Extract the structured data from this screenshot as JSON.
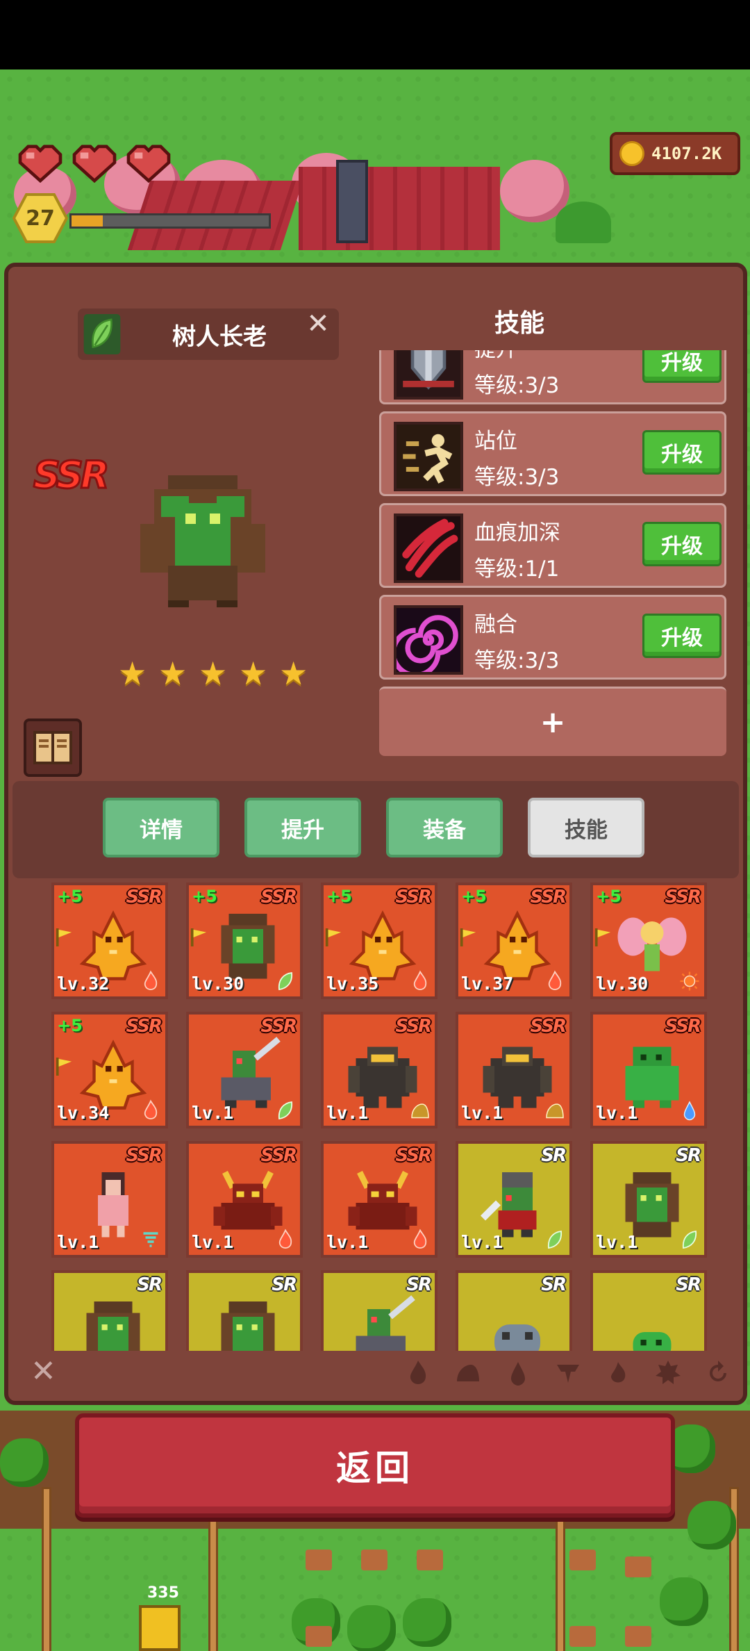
{
  "hud": {
    "hearts": 3,
    "player_level": "27",
    "xp_progress": 0.16,
    "coins": "4107.2K",
    "farmer_counter": "335"
  },
  "hero": {
    "name": "树人长老",
    "rarity": "SSR",
    "stars": 5,
    "element_icon": "leaf-icon"
  },
  "skills": {
    "title": "技能",
    "items": [
      {
        "name": "提升",
        "level": "等级:3/3",
        "icon": "shield-skill-icon",
        "button": "升级"
      },
      {
        "name": "站位",
        "level": "等级:3/3",
        "icon": "running-skill-icon",
        "button": "升级"
      },
      {
        "name": "血痕加深",
        "level": "等级:1/1",
        "icon": "claw-skill-icon",
        "button": "升级"
      },
      {
        "name": "融合",
        "level": "等级:3/3",
        "icon": "spiral-skill-icon",
        "button": "升级"
      }
    ],
    "add_label": "+"
  },
  "tabs": [
    {
      "label": "详情",
      "active": false
    },
    {
      "label": "提升",
      "active": false
    },
    {
      "label": "装备",
      "active": false
    },
    {
      "label": "技能",
      "active": true
    }
  ],
  "roster": [
    {
      "rank": "SSR",
      "plus": "+5",
      "level": "lv.32",
      "unit": "fire-spirit",
      "element": "fire",
      "flag": true
    },
    {
      "rank": "SSR",
      "plus": "+5",
      "level": "lv.30",
      "unit": "treant",
      "element": "leaf",
      "flag": true
    },
    {
      "rank": "SSR",
      "plus": "+5",
      "level": "lv.35",
      "unit": "fire-spirit",
      "element": "fire",
      "flag": true
    },
    {
      "rank": "SSR",
      "plus": "+5",
      "level": "lv.37",
      "unit": "fire-spirit",
      "element": "fire",
      "flag": true
    },
    {
      "rank": "SSR",
      "plus": "+5",
      "level": "lv.30",
      "unit": "fairy",
      "element": "sun",
      "flag": true
    },
    {
      "rank": "SSR",
      "plus": "+5",
      "level": "lv.34",
      "unit": "fire-spirit",
      "element": "fire",
      "flag": true
    },
    {
      "rank": "SSR",
      "plus": "",
      "level": "lv.1",
      "unit": "orc-rider",
      "element": "leaf",
      "flag": false
    },
    {
      "rank": "SSR",
      "plus": "",
      "level": "lv.1",
      "unit": "rock-golem",
      "element": "earth",
      "flag": false
    },
    {
      "rank": "SSR",
      "plus": "",
      "level": "lv.1",
      "unit": "rock-golem",
      "element": "earth",
      "flag": false
    },
    {
      "rank": "SSR",
      "plus": "",
      "level": "lv.1",
      "unit": "slime-golem",
      "element": "water",
      "flag": false
    },
    {
      "rank": "SSR",
      "plus": "",
      "level": "lv.1",
      "unit": "pink-girl",
      "element": "wind",
      "flag": false
    },
    {
      "rank": "SSR",
      "plus": "",
      "level": "lv.1",
      "unit": "demon",
      "element": "fire",
      "flag": false
    },
    {
      "rank": "SSR",
      "plus": "",
      "level": "lv.1",
      "unit": "demon",
      "element": "fire",
      "flag": false
    },
    {
      "rank": "SR",
      "plus": "",
      "level": "lv.1",
      "unit": "goblin-warrior",
      "element": "leaf",
      "flag": false
    },
    {
      "rank": "SR",
      "plus": "",
      "level": "lv.1",
      "unit": "treant",
      "element": "leaf",
      "flag": false
    },
    {
      "rank": "SR",
      "plus": "",
      "level": "",
      "unit": "treant",
      "element": "",
      "flag": false
    },
    {
      "rank": "SR",
      "plus": "",
      "level": "",
      "unit": "treant",
      "element": "",
      "flag": false
    },
    {
      "rank": "SR",
      "plus": "",
      "level": "",
      "unit": "orc-rider",
      "element": "",
      "flag": false
    },
    {
      "rank": "SR",
      "plus": "",
      "level": "",
      "unit": "stone-beast",
      "element": "",
      "flag": false
    },
    {
      "rank": "SR",
      "plus": "",
      "level": "",
      "unit": "slime",
      "element": "",
      "flag": false
    }
  ],
  "filters": [
    "fire-filter-icon",
    "earth-filter-icon",
    "water-filter-icon",
    "wind-filter-icon",
    "flame-filter-icon",
    "gear-filter-icon",
    "refresh-filter-icon"
  ],
  "back_button": "返回",
  "colors": {
    "panel": "#7e443a",
    "ssr_card": "#e0532b",
    "sr_card": "#c5b62a",
    "tab_green": "#6cbd84",
    "upgrade_green": "#4fbf3a",
    "back_red": "#c0353f"
  }
}
